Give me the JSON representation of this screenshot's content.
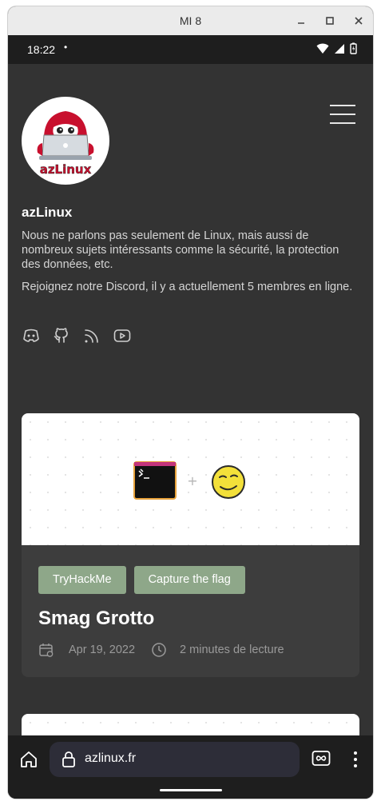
{
  "window": {
    "title": "MI 8"
  },
  "status_bar": {
    "time": "18:22",
    "dot": "•"
  },
  "site": {
    "name": "azLinux",
    "logo_text": "azLinux",
    "description": "Nous ne parlons pas seulement de Linux, mais aussi de nombreux sujets intéressants comme la sécurité, la protection des données, etc.",
    "discord_text": "Rejoignez notre Discord, il y a actuellement 5 membres en ligne.",
    "socials": [
      "discord-icon",
      "github-icon",
      "rss-icon",
      "youtube-icon"
    ]
  },
  "posts": [
    {
      "tags": [
        "TryHackMe",
        "Capture the flag"
      ],
      "title": "Smag Grotto",
      "date": "Apr 19, 2022",
      "reading_time": "2 minutes de lecture",
      "image_plus": "+"
    }
  ],
  "browser": {
    "url": "azlinux.fr"
  },
  "colors": {
    "page_bg": "#333333",
    "tag_bg": "#8ea789",
    "card_bg": "#3d3d3d"
  }
}
